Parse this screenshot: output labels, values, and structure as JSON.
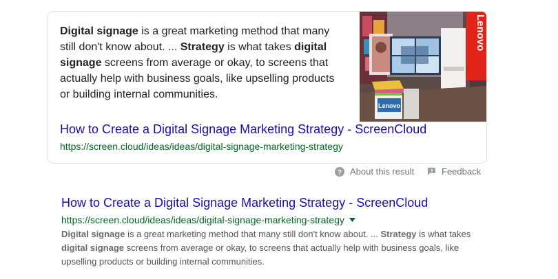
{
  "featured": {
    "snippet_parts": [
      {
        "text": "Digital signage",
        "bold": true
      },
      {
        "text": " is a great marketing method that many still don't know about. ... ",
        "bold": false
      },
      {
        "text": "Strategy",
        "bold": true
      },
      {
        "text": " is what takes ",
        "bold": false
      },
      {
        "text": "digital signage",
        "bold": true
      },
      {
        "text": " screens from average or okay, to screens that actually help with business goals, like upselling products or building internal communities.",
        "bold": false
      }
    ],
    "title": "How to Create a Digital Signage Marketing Strategy - ScreenCloud",
    "url": "https://screen.cloud/ideas/ideas/digital-signage-marketing-strategy",
    "image": {
      "sign_text_1": "Lenovo",
      "sign_text_2": "Lenovo"
    }
  },
  "meta": {
    "about_label": "About this result",
    "feedback_label": "Feedback"
  },
  "result": {
    "title": "How to Create a Digital Signage Marketing Strategy - ScreenCloud",
    "url": "https://screen.cloud/ideas/ideas/digital-signage-marketing-strategy",
    "desc_parts": [
      {
        "text": "Digital signage",
        "bold": true
      },
      {
        "text": " is a great marketing method that many still don't know about. ... ",
        "bold": false
      },
      {
        "text": "Strategy",
        "bold": true
      },
      {
        "text": " is what takes ",
        "bold": false
      },
      {
        "text": "digital signage",
        "bold": true
      },
      {
        "text": " screens from average or okay, to screens that actually help with business goals, like upselling products or building internal communities.",
        "bold": false
      }
    ]
  },
  "colors": {
    "link": "#1a0dab",
    "url": "#006621",
    "lenovo_red": "#e2231a"
  }
}
